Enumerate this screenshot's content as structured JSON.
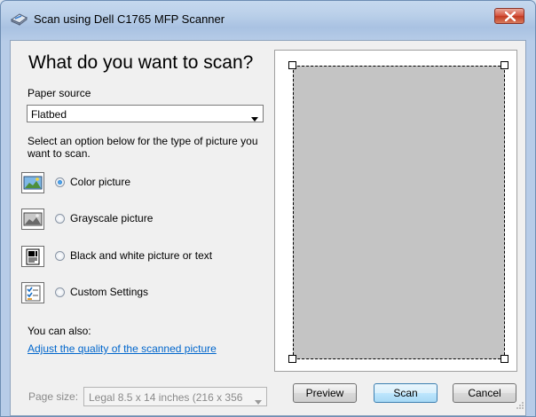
{
  "window": {
    "title": "Scan using Dell C1765 MFP Scanner"
  },
  "icons": {
    "app": "scanner-icon",
    "close": "close-icon",
    "dropdown": "chevron-down-icon"
  },
  "main": {
    "heading": "What do you want to scan?",
    "paper_source_label": "Paper source",
    "paper_source_value": "Flatbed",
    "instructions_line1": "Select an option below for the type of picture you",
    "instructions_line2": "want to scan.",
    "options": [
      {
        "label": "Color picture",
        "checked": true,
        "icon": "color-picture-icon"
      },
      {
        "label": "Grayscale picture",
        "checked": false,
        "icon": "grayscale-picture-icon"
      },
      {
        "label": "Black and white picture or text",
        "checked": false,
        "icon": "black-white-picture-icon"
      },
      {
        "label": "Custom Settings",
        "checked": false,
        "icon": "custom-settings-icon"
      }
    ],
    "you_can_also": "You can also:",
    "adjust_link": "Adjust the quality of the scanned picture",
    "page_size_label": "Page size:",
    "page_size_value": "Legal 8.5 x 14 inches (216 x 356"
  },
  "buttons": {
    "preview": "Preview",
    "scan": "Scan",
    "cancel": "Cancel"
  },
  "colors": {
    "link": "#0066cc",
    "close_button": "#c33a22",
    "scan_area": "#c4c4c4"
  }
}
